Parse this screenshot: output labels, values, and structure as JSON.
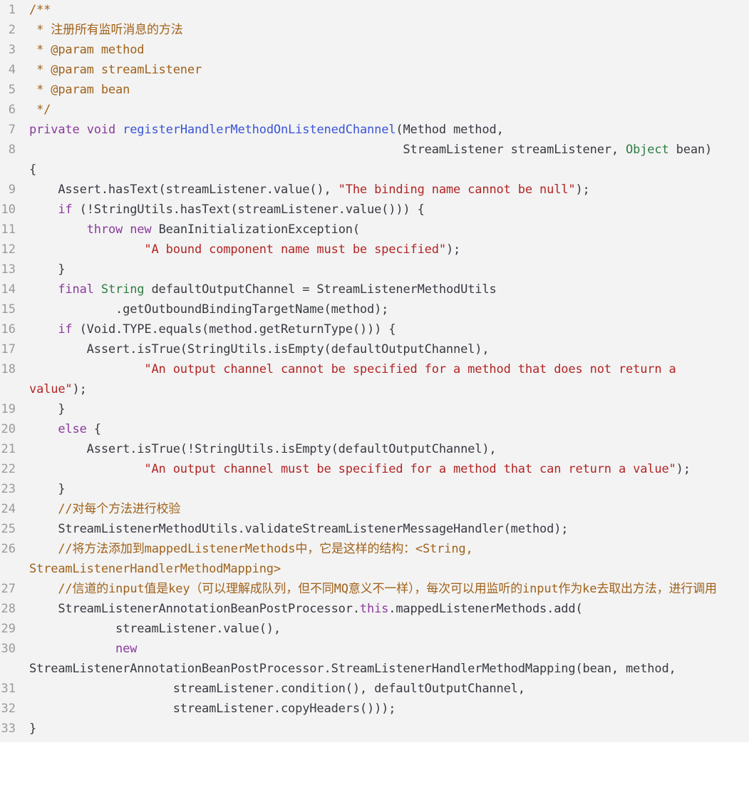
{
  "colors": {
    "background": "#f3f3f3",
    "line_number": "#9a9a9a",
    "plain": "#383a42",
    "comment": "#a0621b",
    "keyword": "#8a3b9c",
    "function": "#3b54d6",
    "string": "#b32424",
    "type": "#2f7d45"
  },
  "lines": [
    {
      "n": "1",
      "tokens": [
        {
          "t": "c",
          "s": "/**"
        }
      ]
    },
    {
      "n": "2",
      "tokens": [
        {
          "t": "c",
          "s": " * 注册所有监听消息的方法"
        }
      ]
    },
    {
      "n": "3",
      "tokens": [
        {
          "t": "c",
          "s": " * @param method"
        }
      ]
    },
    {
      "n": "4",
      "tokens": [
        {
          "t": "c",
          "s": " * @param streamListener"
        }
      ]
    },
    {
      "n": "5",
      "tokens": [
        {
          "t": "c",
          "s": " * @param bean"
        }
      ]
    },
    {
      "n": "6",
      "tokens": [
        {
          "t": "c",
          "s": " */"
        }
      ]
    },
    {
      "n": "7",
      "tokens": [
        {
          "t": "k",
          "s": "private"
        },
        {
          "t": "p",
          "s": " "
        },
        {
          "t": "k",
          "s": "void"
        },
        {
          "t": "p",
          "s": " "
        },
        {
          "t": "f",
          "s": "registerHandlerMethodOnListenedChannel"
        },
        {
          "t": "p",
          "s": "(Method method,"
        }
      ]
    },
    {
      "n": "8",
      "tokens": [
        {
          "t": "p",
          "s": "                                                    StreamListener streamListener, "
        },
        {
          "t": "y",
          "s": "Object"
        },
        {
          "t": "p",
          "s": " bean)"
        }
      ]
    },
    {
      "n": "",
      "tokens": [
        {
          "t": "p",
          "s": "{"
        }
      ]
    },
    {
      "n": "9",
      "tokens": [
        {
          "t": "p",
          "s": "    Assert.hasText(streamListener.value(), "
        },
        {
          "t": "s",
          "s": "\"The binding name cannot be null\""
        },
        {
          "t": "p",
          "s": ");"
        }
      ]
    },
    {
      "n": "10",
      "tokens": [
        {
          "t": "p",
          "s": "    "
        },
        {
          "t": "k",
          "s": "if"
        },
        {
          "t": "p",
          "s": " (!StringUtils.hasText(streamListener.value())) {"
        }
      ]
    },
    {
      "n": "11",
      "tokens": [
        {
          "t": "p",
          "s": "        "
        },
        {
          "t": "k",
          "s": "throw"
        },
        {
          "t": "p",
          "s": " "
        },
        {
          "t": "k",
          "s": "new"
        },
        {
          "t": "p",
          "s": " BeanInitializationException("
        }
      ]
    },
    {
      "n": "12",
      "tokens": [
        {
          "t": "p",
          "s": "                "
        },
        {
          "t": "s",
          "s": "\"A bound component name must be specified\""
        },
        {
          "t": "p",
          "s": ");"
        }
      ]
    },
    {
      "n": "13",
      "tokens": [
        {
          "t": "p",
          "s": "    }"
        }
      ]
    },
    {
      "n": "14",
      "tokens": [
        {
          "t": "p",
          "s": "    "
        },
        {
          "t": "k",
          "s": "final"
        },
        {
          "t": "p",
          "s": " "
        },
        {
          "t": "y",
          "s": "String"
        },
        {
          "t": "p",
          "s": " defaultOutputChannel = StreamListenerMethodUtils"
        }
      ]
    },
    {
      "n": "15",
      "tokens": [
        {
          "t": "p",
          "s": "            .getOutboundBindingTargetName(method);"
        }
      ]
    },
    {
      "n": "16",
      "tokens": [
        {
          "t": "p",
          "s": "    "
        },
        {
          "t": "k",
          "s": "if"
        },
        {
          "t": "p",
          "s": " (Void.TYPE.equals(method.getReturnType())) {"
        }
      ]
    },
    {
      "n": "17",
      "tokens": [
        {
          "t": "p",
          "s": "        Assert.isTrue(StringUtils.isEmpty(defaultOutputChannel),"
        }
      ]
    },
    {
      "n": "18",
      "tokens": [
        {
          "t": "p",
          "s": "                "
        },
        {
          "t": "s",
          "s": "\"An output channel cannot be specified for a method that does not return a"
        }
      ]
    },
    {
      "n": "",
      "tokens": [
        {
          "t": "s",
          "s": "value\""
        },
        {
          "t": "p",
          "s": ");"
        }
      ]
    },
    {
      "n": "19",
      "tokens": [
        {
          "t": "p",
          "s": "    }"
        }
      ]
    },
    {
      "n": "20",
      "tokens": [
        {
          "t": "p",
          "s": "    "
        },
        {
          "t": "k",
          "s": "else"
        },
        {
          "t": "p",
          "s": " {"
        }
      ]
    },
    {
      "n": "21",
      "tokens": [
        {
          "t": "p",
          "s": "        Assert.isTrue(!StringUtils.isEmpty(defaultOutputChannel),"
        }
      ]
    },
    {
      "n": "22",
      "tokens": [
        {
          "t": "p",
          "s": "                "
        },
        {
          "t": "s",
          "s": "\"An output channel must be specified for a method that can return a value\""
        },
        {
          "t": "p",
          "s": ");"
        }
      ]
    },
    {
      "n": "23",
      "tokens": [
        {
          "t": "p",
          "s": "    }"
        }
      ]
    },
    {
      "n": "24",
      "tokens": [
        {
          "t": "p",
          "s": "    "
        },
        {
          "t": "c",
          "s": "//对每个方法进行校验"
        }
      ]
    },
    {
      "n": "25",
      "tokens": [
        {
          "t": "p",
          "s": "    StreamListenerMethodUtils.validateStreamListenerMessageHandler(method);"
        }
      ]
    },
    {
      "n": "26",
      "tokens": [
        {
          "t": "p",
          "s": "    "
        },
        {
          "t": "c",
          "s": "//将方法添加到mappedListenerMethods中，它是这样的结构：<String,"
        }
      ]
    },
    {
      "n": "",
      "tokens": [
        {
          "t": "c",
          "s": "StreamListenerHandlerMethodMapping>"
        }
      ]
    },
    {
      "n": "27",
      "tokens": [
        {
          "t": "p",
          "s": "    "
        },
        {
          "t": "c",
          "s": "//信道的input值是key（可以理解成队列，但不同MQ意义不一样），每次可以用监听的input作为ke去取出方法，进行调用"
        }
      ]
    },
    {
      "n": "28",
      "tokens": [
        {
          "t": "p",
          "s": "    StreamListenerAnnotationBeanPostProcessor."
        },
        {
          "t": "k",
          "s": "this"
        },
        {
          "t": "p",
          "s": ".mappedListenerMethods.add("
        }
      ]
    },
    {
      "n": "29",
      "tokens": [
        {
          "t": "p",
          "s": "            streamListener.value(),"
        }
      ]
    },
    {
      "n": "30",
      "tokens": [
        {
          "t": "p",
          "s": "            "
        },
        {
          "t": "k",
          "s": "new"
        }
      ]
    },
    {
      "n": "",
      "tokens": [
        {
          "t": "p",
          "s": "StreamListenerAnnotationBeanPostProcessor.StreamListenerHandlerMethodMapping(bean, method,"
        }
      ]
    },
    {
      "n": "31",
      "tokens": [
        {
          "t": "p",
          "s": "                    streamListener.condition(), defaultOutputChannel,"
        }
      ]
    },
    {
      "n": "32",
      "tokens": [
        {
          "t": "p",
          "s": "                    streamListener.copyHeaders()));"
        }
      ]
    },
    {
      "n": "33",
      "tokens": [
        {
          "t": "p",
          "s": "}"
        }
      ]
    }
  ]
}
